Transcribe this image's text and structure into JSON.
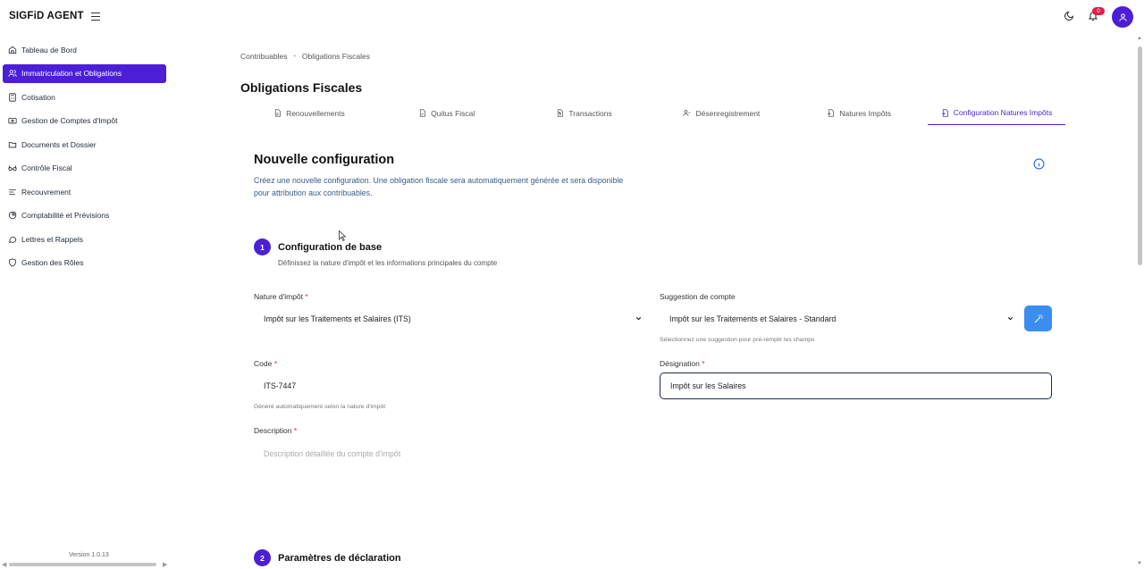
{
  "app": {
    "brand": "SIGFiD AGENT",
    "version": "Version 1.0.13"
  },
  "notifications": {
    "count": "0"
  },
  "sidebar": {
    "items": [
      {
        "label": "Tableau de Bord",
        "icon": "home-icon"
      },
      {
        "label": "Immatriculation et Obligations",
        "icon": "users-icon",
        "active": true
      },
      {
        "label": "Cotisation",
        "icon": "calculator-icon"
      },
      {
        "label": "Gestion de Comptes d'Impôt",
        "icon": "wallet-icon"
      },
      {
        "label": "Documents et Dossier",
        "icon": "folder-icon"
      },
      {
        "label": "Contrôle Fiscal",
        "icon": "glasses-icon"
      },
      {
        "label": "Recouvrement",
        "icon": "list-icon"
      },
      {
        "label": "Comptabilité et Prévisions",
        "icon": "chart-pie-icon"
      },
      {
        "label": "Lettres et Rappels",
        "icon": "message-icon"
      },
      {
        "label": "Gestion des Rôles",
        "icon": "shield-icon"
      }
    ]
  },
  "breadcrumb": {
    "parent": "Contribuables",
    "current": "Obligations Fiscales"
  },
  "page": {
    "title": "Obligations Fiscales"
  },
  "tabs": [
    {
      "label": "Renouvellements",
      "icon": "file-text-icon"
    },
    {
      "label": "Quitus Fiscal",
      "icon": "file-check-icon"
    },
    {
      "label": "Transactions",
      "icon": "file-dollar-icon"
    },
    {
      "label": "Désenregistrement",
      "icon": "user-minus-icon"
    },
    {
      "label": "Natures Impôts",
      "icon": "file-input-icon"
    },
    {
      "label": "Configuration Natures Impôts",
      "icon": "file-cog-icon",
      "active": true
    }
  ],
  "form": {
    "title": "Nouvelle configuration",
    "description": "Créez une nouvelle configuration. Une obligation fiscale sera automatiquement générée et sera disponible pour attribution aux contribuables.",
    "step1": {
      "number": "1",
      "title": "Configuration de base",
      "subtitle": "Définissez la nature d'impôt et les informations principales du compte"
    },
    "step2": {
      "number": "2",
      "title": "Paramètres de déclaration"
    },
    "nature": {
      "label": "Nature d'impôt",
      "required": "*",
      "value": "Impôt sur les Traitements et Salaires (ITS)"
    },
    "suggestion": {
      "label": "Suggestion de compte",
      "value": "Impôt sur les Traitements et Salaires - Standard",
      "hint": "Sélectionnez une suggestion pour pré-remplir les champs"
    },
    "code": {
      "label": "Code",
      "required": "*",
      "value": "ITS-7447",
      "hint": "Généré automatiquement selon la nature d'impôt"
    },
    "designation": {
      "label": "Désignation",
      "required": "*",
      "value": "Impôt sur les Salaires"
    },
    "desc_field": {
      "label": "Description",
      "required": "*",
      "placeholder": "Description détaillée du compte d'impôt"
    }
  },
  "colors": {
    "accent": "#4c1fd6",
    "wand": "#3b8ef0",
    "badge": "#e11d48"
  }
}
